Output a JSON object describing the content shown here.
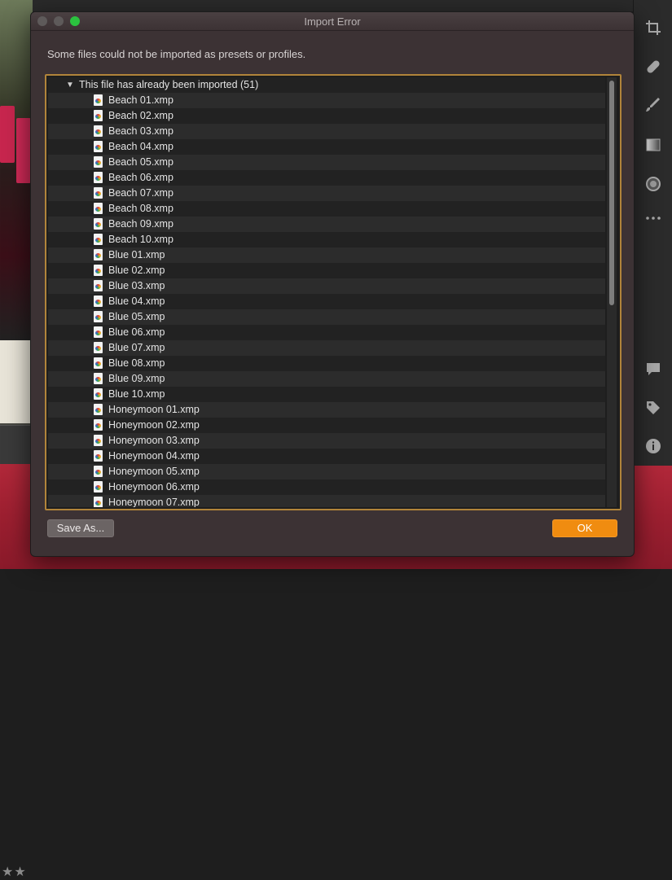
{
  "dialog": {
    "title": "Import Error",
    "message": "Some files could not be imported as presets or profiles.",
    "group_label": "This file has already been imported (51)",
    "save_label": "Save As...",
    "ok_label": "OK",
    "accent_color": "#f08c10",
    "frame_color": "#b1843a"
  },
  "files": [
    "Beach 01.xmp",
    "Beach 02.xmp",
    "Beach 03.xmp",
    "Beach 04.xmp",
    "Beach 05.xmp",
    "Beach 06.xmp",
    "Beach 07.xmp",
    "Beach 08.xmp",
    "Beach 09.xmp",
    "Beach 10.xmp",
    "Blue 01.xmp",
    "Blue 02.xmp",
    "Blue 03.xmp",
    "Blue 04.xmp",
    "Blue 05.xmp",
    "Blue 06.xmp",
    "Blue 07.xmp",
    "Blue 08.xmp",
    "Blue 09.xmp",
    "Blue 10.xmp",
    "Honeymoon 01.xmp",
    "Honeymoon 02.xmp",
    "Honeymoon 03.xmp",
    "Honeymoon 04.xmp",
    "Honeymoon 05.xmp",
    "Honeymoon 06.xmp",
    "Honeymoon 07.xmp"
  ],
  "toolbar": {
    "icons": [
      "crop-icon",
      "healing-icon",
      "brush-icon",
      "gradient-icon",
      "radial-icon",
      "more-icon",
      "comment-icon",
      "tag-icon",
      "info-icon"
    ]
  },
  "background": {
    "rating_stars": "★★"
  }
}
